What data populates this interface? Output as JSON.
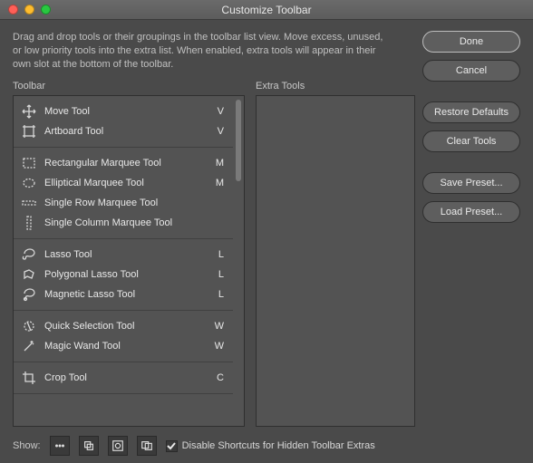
{
  "window": {
    "title": "Customize Toolbar"
  },
  "description": "Drag and drop tools or their groupings in the toolbar list view. Move excess, unused, or low priority tools into the extra list. When enabled, extra tools will appear in their own slot at the bottom of the toolbar.",
  "labels": {
    "toolbar": "Toolbar",
    "extra": "Extra Tools",
    "show": "Show:"
  },
  "buttons": {
    "done": "Done",
    "cancel": "Cancel",
    "restore": "Restore Defaults",
    "clear": "Clear Tools",
    "save": "Save Preset...",
    "load": "Load Preset..."
  },
  "footer": {
    "checkbox_label": "Disable Shortcuts for Hidden Toolbar Extras",
    "checked": true
  },
  "tool_groups": [
    {
      "tools": [
        {
          "name": "Move Tool",
          "key": "V",
          "icon": "move"
        },
        {
          "name": "Artboard Tool",
          "key": "V",
          "icon": "artboard"
        }
      ]
    },
    {
      "tools": [
        {
          "name": "Rectangular Marquee Tool",
          "key": "M",
          "icon": "rect-marquee"
        },
        {
          "name": "Elliptical Marquee Tool",
          "key": "M",
          "icon": "ellipse-marquee"
        },
        {
          "name": "Single Row Marquee Tool",
          "key": "",
          "icon": "row-marquee"
        },
        {
          "name": "Single Column Marquee Tool",
          "key": "",
          "icon": "col-marquee"
        }
      ]
    },
    {
      "tools": [
        {
          "name": "Lasso Tool",
          "key": "L",
          "icon": "lasso"
        },
        {
          "name": "Polygonal Lasso Tool",
          "key": "L",
          "icon": "poly-lasso"
        },
        {
          "name": "Magnetic Lasso Tool",
          "key": "L",
          "icon": "mag-lasso"
        }
      ]
    },
    {
      "tools": [
        {
          "name": "Quick Selection Tool",
          "key": "W",
          "icon": "quick-sel"
        },
        {
          "name": "Magic Wand Tool",
          "key": "W",
          "icon": "wand"
        }
      ]
    },
    {
      "tools": [
        {
          "name": "Crop Tool",
          "key": "C",
          "icon": "crop"
        }
      ]
    }
  ]
}
